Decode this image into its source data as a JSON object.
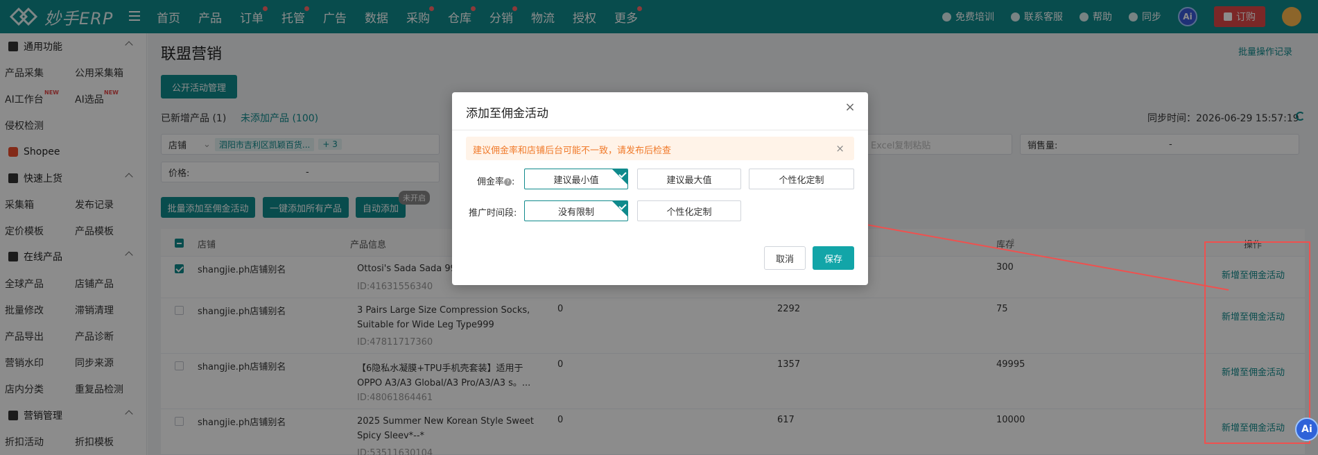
{
  "app": {
    "logo_text": "妙手ERP"
  },
  "nav": {
    "items": [
      {
        "label": "首页",
        "dot": false
      },
      {
        "label": "产品",
        "dot": false
      },
      {
        "label": "订单",
        "dot": true
      },
      {
        "label": "托管",
        "dot": true
      },
      {
        "label": "广告",
        "dot": false
      },
      {
        "label": "数据",
        "dot": false
      },
      {
        "label": "采购",
        "dot": true
      },
      {
        "label": "仓库",
        "dot": true
      },
      {
        "label": "分销",
        "dot": true
      },
      {
        "label": "物流",
        "dot": false
      },
      {
        "label": "授权",
        "dot": false
      },
      {
        "label": "更多",
        "dot": true
      }
    ],
    "right": {
      "training": "免费培训",
      "support": "联系客服",
      "help": "帮助",
      "sync": "同步",
      "ai": "Ai",
      "order": "订购"
    }
  },
  "sidebar": {
    "general": "通用功能",
    "general_items": [
      "产品采集",
      "公用采集箱",
      "AI工作台",
      "AI选品",
      "侵权检测"
    ],
    "new_badge": "NEW",
    "shopee": "Shopee",
    "quick_upload": "快速上货",
    "quick_items": [
      "采集箱",
      "发布记录",
      "定价模板",
      "产品模板"
    ],
    "online": "在线产品",
    "online_items": [
      "全球产品",
      "店铺产品",
      "批量修改",
      "滞销清理",
      "产品导出",
      "产品诊断",
      "营销水印",
      "同步来源",
      "店内分类",
      "重复品检测"
    ],
    "marketing": "营销管理",
    "marketing_items": [
      "折扣活动",
      "折扣模板"
    ]
  },
  "page": {
    "title": "联盟营销",
    "batch_log": "批量操作记录",
    "public_btn": "公开活动管理",
    "tab_added": "已新增产品 (1)",
    "tab_not_added": "未添加产品 (100)",
    "sync_time": "同步时间：2026-06-29 15:57:19",
    "filter_shop_label": "店铺",
    "filter_shop_chip": "泗阳市吉利区凯颖百货...",
    "filter_shop_more": "+ 3",
    "filter_excel_placeholder": "Excel复制粘贴",
    "filter_sales_label": "销售量:",
    "filter_sales_dash": "-",
    "filter_price_label": "价格:",
    "filter_price_dash": "-",
    "btn_batch_add": "批量添加至佣金活动",
    "btn_add_all": "一键添加所有产品",
    "btn_auto_add": "自动添加",
    "auto_add_status": "未开启"
  },
  "table": {
    "headers": {
      "shop": "店铺",
      "product": "产品信息",
      "stock": "库存",
      "op": "操作"
    },
    "rows": [
      {
        "shop": "shangjie.ph店铺别名",
        "name1": "Ottosi's Sada Sada 99",
        "name2": "",
        "id": "ID:41631556340",
        "c3": "",
        "c4": "",
        "stock": "300",
        "op": "新增至佣金活动",
        "checked": true
      },
      {
        "shop": "shangjie.ph店铺别名",
        "name1": "3 Pairs Large Size Compression Socks,",
        "name2": "Suitable for Wide Leg Type999",
        "id": "ID:47811717360",
        "c3": "0",
        "c4": "2292",
        "stock": "75",
        "op": "新增至佣金活动",
        "checked": false
      },
      {
        "shop": "shangjie.ph店铺别名",
        "name1": "【6隐私水凝膜+TPU手机壳套装】适用于",
        "name2": "OPPO A3/A3 Global/A3 Pro/A3/A3 s。...",
        "id": "ID:48061864461",
        "c3": "0",
        "c4": "1357",
        "stock": "49995",
        "op": "新增至佣金活动",
        "checked": false
      },
      {
        "shop": "shangjie.ph店铺别名",
        "name1": "2025 Summer New Korean Style Sweet",
        "name2": "Spicy Sleev*--*",
        "id": "ID:53511630104",
        "c3": "0",
        "c4": "617",
        "stock": "10000",
        "op": "新增至佣金活动",
        "checked": false
      }
    ]
  },
  "dialog": {
    "title": "添加至佣金活动",
    "warning": "建议佣金率和店铺后台可能不一致，请发布后检查",
    "rate_label": "佣金率",
    "rate_options": [
      "建议最小值",
      "建议最大值",
      "个性化定制"
    ],
    "period_label": "推广时间段:",
    "period_options": [
      "没有限制",
      "个性化定制"
    ],
    "cancel": "取消",
    "save": "保存"
  },
  "float_ai": "Ai"
}
